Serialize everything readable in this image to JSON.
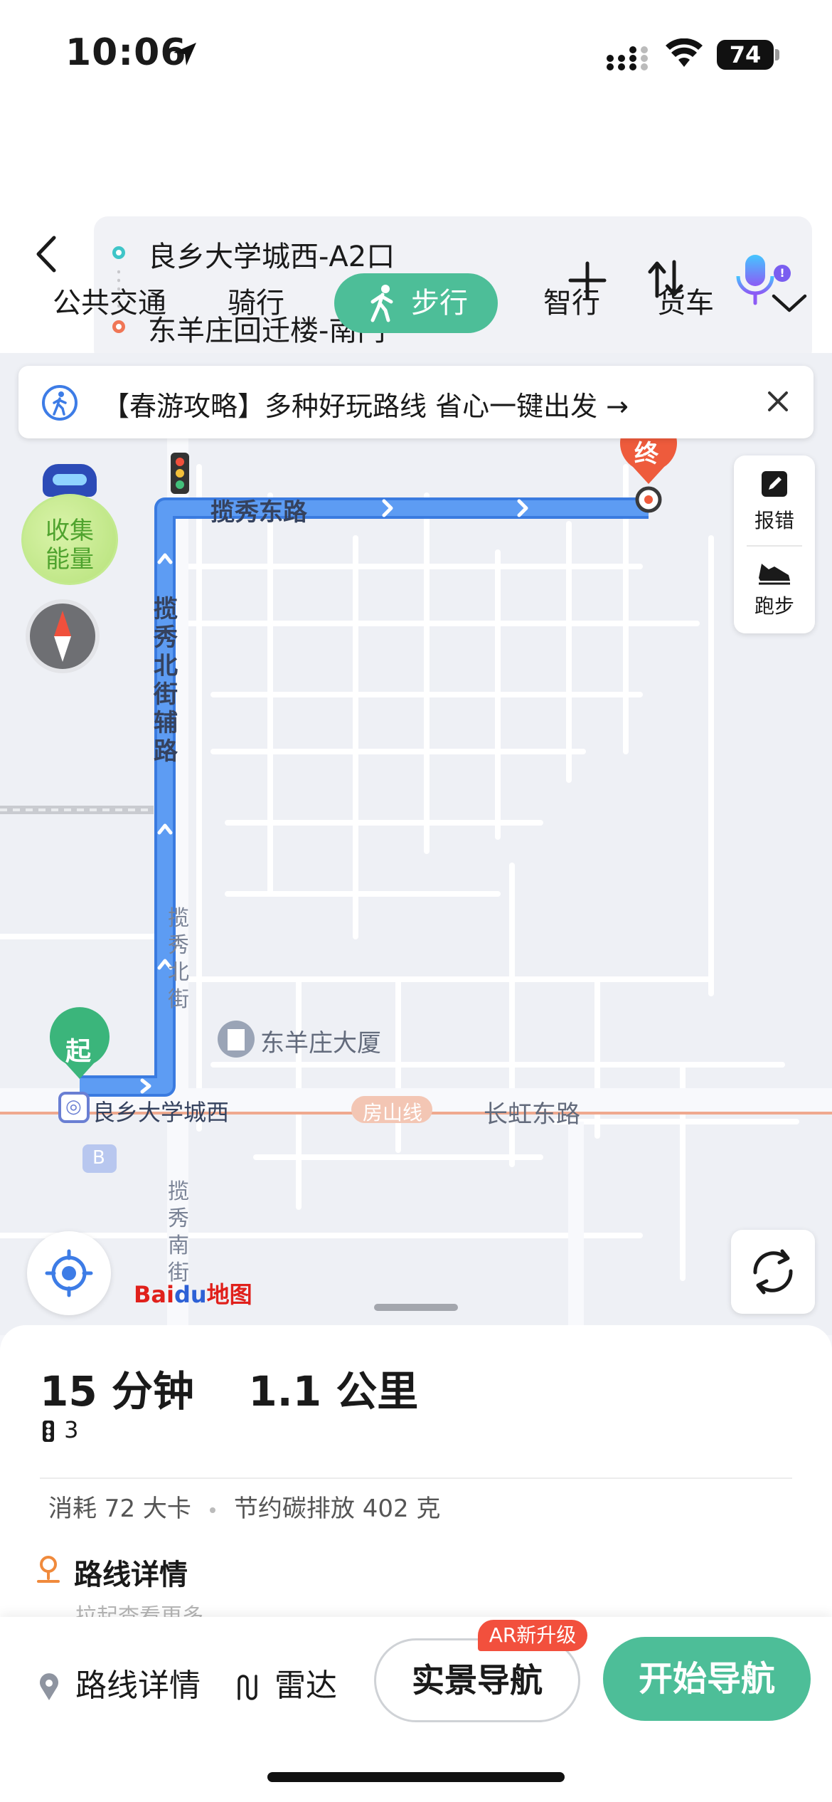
{
  "status_bar": {
    "time": "10:06",
    "battery": "74"
  },
  "route": {
    "from": "良乡大学城西-A2口",
    "to": "东羊庄回迁楼-南门"
  },
  "tabs": [
    {
      "label": "公共交通"
    },
    {
      "label": "骑行"
    },
    {
      "label": "步行",
      "active": true
    },
    {
      "label": "智行"
    },
    {
      "label": "货车"
    }
  ],
  "banner": {
    "text": "【春游攻略】多种好玩路线 省心一键出发 →"
  },
  "map": {
    "energy_label": "收集\n能量",
    "tools": {
      "report": "报错",
      "run": "跑步"
    },
    "labels": {
      "road_east": "揽秀东路",
      "road_north_aux": "揽秀北街辅路",
      "road_north": "揽秀北街",
      "road_south": "揽秀南街",
      "building": "东羊庄大厦",
      "station": "良乡大学城西",
      "line": "房山线",
      "road_changhong": "长虹东路",
      "start": "起",
      "end": "终",
      "exit_b": "B"
    },
    "logo": {
      "part1": "Bai",
      "paw": "du",
      "part2": "地图"
    }
  },
  "sheet": {
    "duration": "15 分钟",
    "distance": "1.1 公里",
    "traffic_lights": "3",
    "calories": "消耗 72 大卡",
    "carbon": "节约碳排放 402 克",
    "details_title": "路线详情",
    "hint": "拉起查看更多"
  },
  "bottom_bar": {
    "details": "路线详情",
    "radar": "雷达",
    "ar_nav": "实景导航",
    "ar_badge": "AR新升级",
    "start_nav": "开始导航"
  },
  "colors": {
    "accent": "#4dbe98",
    "route": "#4b8ef0",
    "end_pin": "#ee5b3c",
    "start_pin": "#3bb57b"
  },
  "icons": [
    "location-arrow-icon",
    "signal-icon",
    "wifi-icon",
    "battery-icon",
    "back-icon",
    "plus-icon",
    "swap-icon",
    "mic-icon",
    "walk-icon",
    "chevron-down-icon",
    "pedestrian-icon",
    "close-icon",
    "compass-icon",
    "edit-icon",
    "shoe-icon",
    "locate-icon",
    "refresh-icon",
    "traffic-light-icon",
    "pin-icon",
    "radar-icon"
  ]
}
